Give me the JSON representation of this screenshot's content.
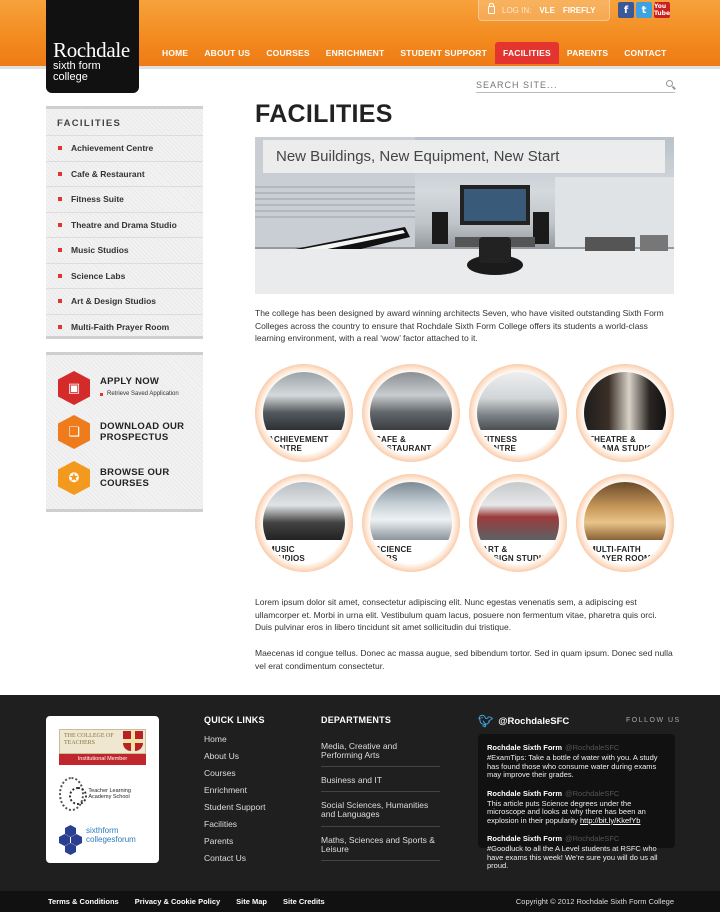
{
  "header": {
    "logo": {
      "name": "Rochdale",
      "line2": "sixth form",
      "line3": "college"
    },
    "login": {
      "label": "LOG IN:",
      "links": [
        "VLE",
        "FIREFLY"
      ]
    },
    "social": [
      {
        "name": "facebook-icon",
        "glyph": "f"
      },
      {
        "name": "twitter-icon",
        "glyph": "t"
      },
      {
        "name": "youtube-icon",
        "glyph": "You Tube"
      }
    ],
    "nav": [
      "HOME",
      "ABOUT US",
      "COURSES",
      "ENRICHMENT",
      "STUDENT SUPPORT",
      "FACILITIES",
      "PARENTS",
      "CONTACT"
    ],
    "active_nav": "FACILITIES"
  },
  "search": {
    "placeholder": "SEARCH SITE..."
  },
  "sidebar": {
    "title": "FACILITIES",
    "items": [
      "Achievement Centre",
      "Cafe & Restaurant",
      "Fitness Suite",
      "Theatre and Drama Studio",
      "Music Studios",
      "Science Labs",
      "Art & Design Studios",
      "Multi-Faith Prayer Room"
    ],
    "actions": {
      "apply": {
        "title": "APPLY NOW",
        "sub": "Retrieve Saved Application"
      },
      "prospectus": {
        "line1": "DOWNLOAD OUR",
        "line2": "PROSPECTUS"
      },
      "courses": {
        "line1": "BROWSE OUR",
        "line2": "COURSES"
      }
    }
  },
  "main": {
    "title": "FACILITIES",
    "hero_caption": "New Buildings, New Equipment, New Start",
    "intro": "The college has been designed by award winning architects Seven, who have visited outstanding Sixth Form Colleges across the country to ensure that Rochdale Sixth Form College offers its students a world-class learning environment, with a real ‘wow’ factor attached to it.",
    "facilities": [
      "ACHIEVEMENT\nCENTRE",
      "CAFE &\nRESTAURANT",
      "FITNESS\nCENTRE",
      "THEATRE &\nDRAMA STUDIO",
      "MUSIC\nSTUDIOS",
      "SCIENCE\nLABS",
      "ART &\nDESIGN STUDIOS",
      "MULTI-FAITH\nPRAYER ROOM"
    ],
    "lorem1": "Lorem ipsum dolor sit amet, consectetur adipiscing elit. Nunc egestas venenatis sem, a adipiscing est ullamcorper et. Morbi in urna elit. Vestibulum quam lacus, posuere non fermentum vitae, pharetra quis orci. Duis pulvinar eros in libero tincidunt sit amet sollicitudin dui tristique.",
    "lorem2": "Maecenas id congue tellus. Donec ac massa augue, sed bibendum tortor. Sed in quam ipsum. Donec sed nulla vel erat condimentum consectetur."
  },
  "footer": {
    "partners": {
      "cot_top": "THE COLLEGE OF TEACHERS",
      "cot_bottom": "Institutional Member",
      "tla": "Teacher Learning Academy School",
      "sfcf": "sixthform collegesforum"
    },
    "quick_links_title": "QUICK LINKS",
    "quick_links": [
      "Home",
      "About Us",
      "Courses",
      "Enrichment",
      "Student Support",
      "Facilities",
      "Parents",
      "Contact Us"
    ],
    "departments_title": "DEPARTMENTS",
    "departments": [
      "Media, Creative and Performing Arts",
      "Business and IT",
      "Social Sciences, Humanities and Languages",
      "Maths, Sciences and Sports & Leisure"
    ],
    "twitter_handle": "@RochdaleSFC",
    "follow_us": "FOLLOW US",
    "tweets": [
      {
        "name": "Rochdale Sixth Form",
        "handle": "@RochdaleSFC",
        "text": "#ExamTips: Take a bottle of water with you. A study has found those who consume water during exams may improve their grades.",
        "link": ""
      },
      {
        "name": "Rochdale Sixth Form",
        "handle": "@RochdaleSFC",
        "text": "This article puts Science degrees under the microscope and looks at why there has been an explosion in their popularity ",
        "link": "http://bit.ly/KkefYb"
      },
      {
        "name": "Rochdale Sixth Form",
        "handle": "@RochdaleSFC",
        "text": "#Goodluck to all the A Level students at RSFC who have exams this week! We're sure you will do us all proud.",
        "link": ""
      }
    ],
    "bottom_links": [
      "Terms & Conditions",
      "Privacy & Cookie Policy",
      "Site Map",
      "Site Credits"
    ],
    "copyright": "Copyright © 2012 Rochdale Sixth Form College"
  },
  "colors": {
    "orange": "#f28a1e",
    "red": "#e3342f",
    "dark": "#1f1f1f"
  }
}
